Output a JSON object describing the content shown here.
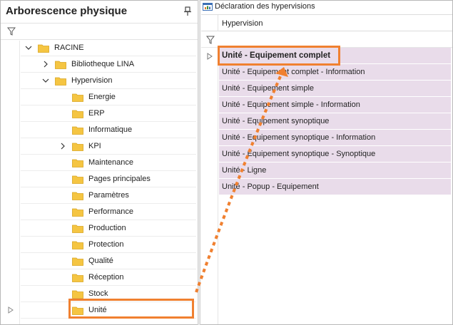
{
  "left_panel": {
    "title": "Arborescence physique",
    "tree": [
      {
        "label": "RACINE",
        "level": 0,
        "chevron": "down"
      },
      {
        "label": "Bibliotheque LINA",
        "level": 1,
        "chevron": "right"
      },
      {
        "label": "Hypervision",
        "level": 1,
        "chevron": "down"
      },
      {
        "label": "Energie",
        "level": 2,
        "chevron": "none"
      },
      {
        "label": "ERP",
        "level": 2,
        "chevron": "none"
      },
      {
        "label": "Informatique",
        "level": 2,
        "chevron": "none"
      },
      {
        "label": "KPI",
        "level": 2,
        "chevron": "right"
      },
      {
        "label": "Maintenance",
        "level": 2,
        "chevron": "none"
      },
      {
        "label": "Pages principales",
        "level": 2,
        "chevron": "none"
      },
      {
        "label": "Paramètres",
        "level": 2,
        "chevron": "none"
      },
      {
        "label": "Performance",
        "level": 2,
        "chevron": "none"
      },
      {
        "label": "Production",
        "level": 2,
        "chevron": "none"
      },
      {
        "label": "Protection",
        "level": 2,
        "chevron": "none"
      },
      {
        "label": "Qualité",
        "level": 2,
        "chevron": "none"
      },
      {
        "label": "Réception",
        "level": 2,
        "chevron": "none"
      },
      {
        "label": "Stock",
        "level": 2,
        "chevron": "none"
      },
      {
        "label": "Unité",
        "level": 2,
        "chevron": "none"
      }
    ]
  },
  "right_panel": {
    "title": "Déclaration des hypervisions",
    "column_header": "Hypervision",
    "rows": [
      "Unité - Equipement complet",
      "Unité - Equipement complet - Information",
      "Unité - Equipement simple",
      "Unité - Equipement simple - Information",
      "Unité - Equipement synoptique",
      "Unité - Equipement synoptique - Information",
      "Unité - Equipement synoptique - Synoptique",
      "Unité - Ligne",
      "Unité - Popup - Equipement"
    ],
    "selected_index": 0
  },
  "colors": {
    "row_background": "#e9dcea",
    "highlight": "#f08030",
    "folder": "#f5c542"
  },
  "icons": {
    "pin": "pin-icon",
    "filter": "filter-icon",
    "folder": "folder-icon",
    "declaration": "declaration-icon"
  }
}
